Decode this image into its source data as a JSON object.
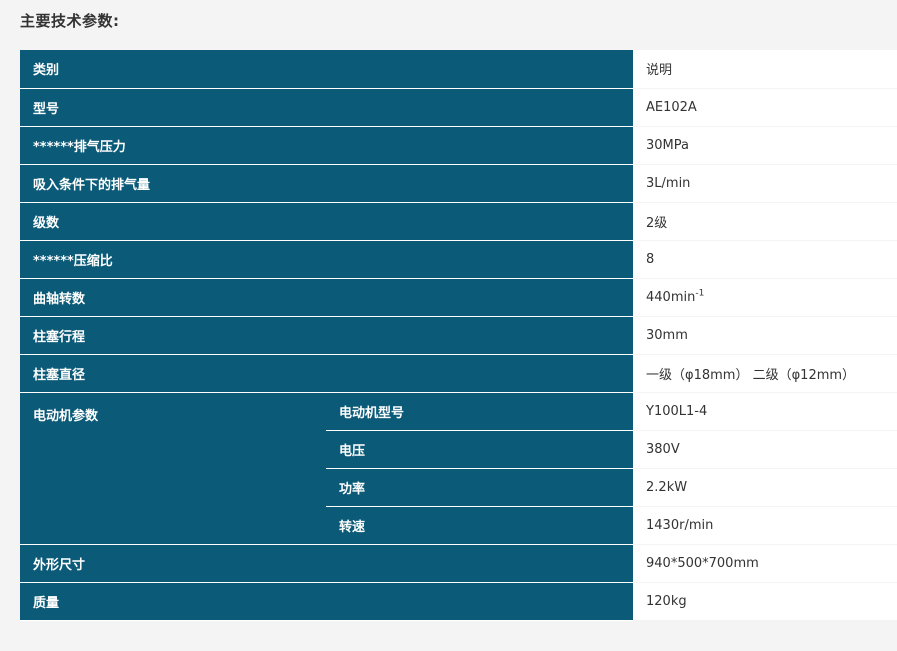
{
  "section_title": "主要技术参数:",
  "rows": [
    {
      "label": "类别",
      "value": "说明"
    },
    {
      "label": "型号",
      "value": "AE102A"
    },
    {
      "label": "******排气压力",
      "value": "30MPa"
    },
    {
      "label": "吸入条件下的排气量",
      "value": "3L/min"
    },
    {
      "label": "级数",
      "value": "2级"
    },
    {
      "label": "******压缩比",
      "value": "8"
    },
    {
      "label": "曲轴转数",
      "value": "440min",
      "value_sup": "-1"
    },
    {
      "label": "柱塞行程",
      "value": "30mm"
    },
    {
      "label": "柱塞直径",
      "value": "一级（φ18mm） 二级（φ12mm）"
    }
  ],
  "motor": {
    "label": "电动机参数",
    "items": [
      {
        "label": "电动机型号",
        "value": "Y100L1-4"
      },
      {
        "label": "电压",
        "value": "380V"
      },
      {
        "label": "功率",
        "value": "2.2kW"
      },
      {
        "label": "转速",
        "value": "1430r/min"
      }
    ]
  },
  "tail_rows": [
    {
      "label": "外形尺寸",
      "value": "940*500*700mm"
    },
    {
      "label": "质量",
      "value": "120kg"
    }
  ]
}
